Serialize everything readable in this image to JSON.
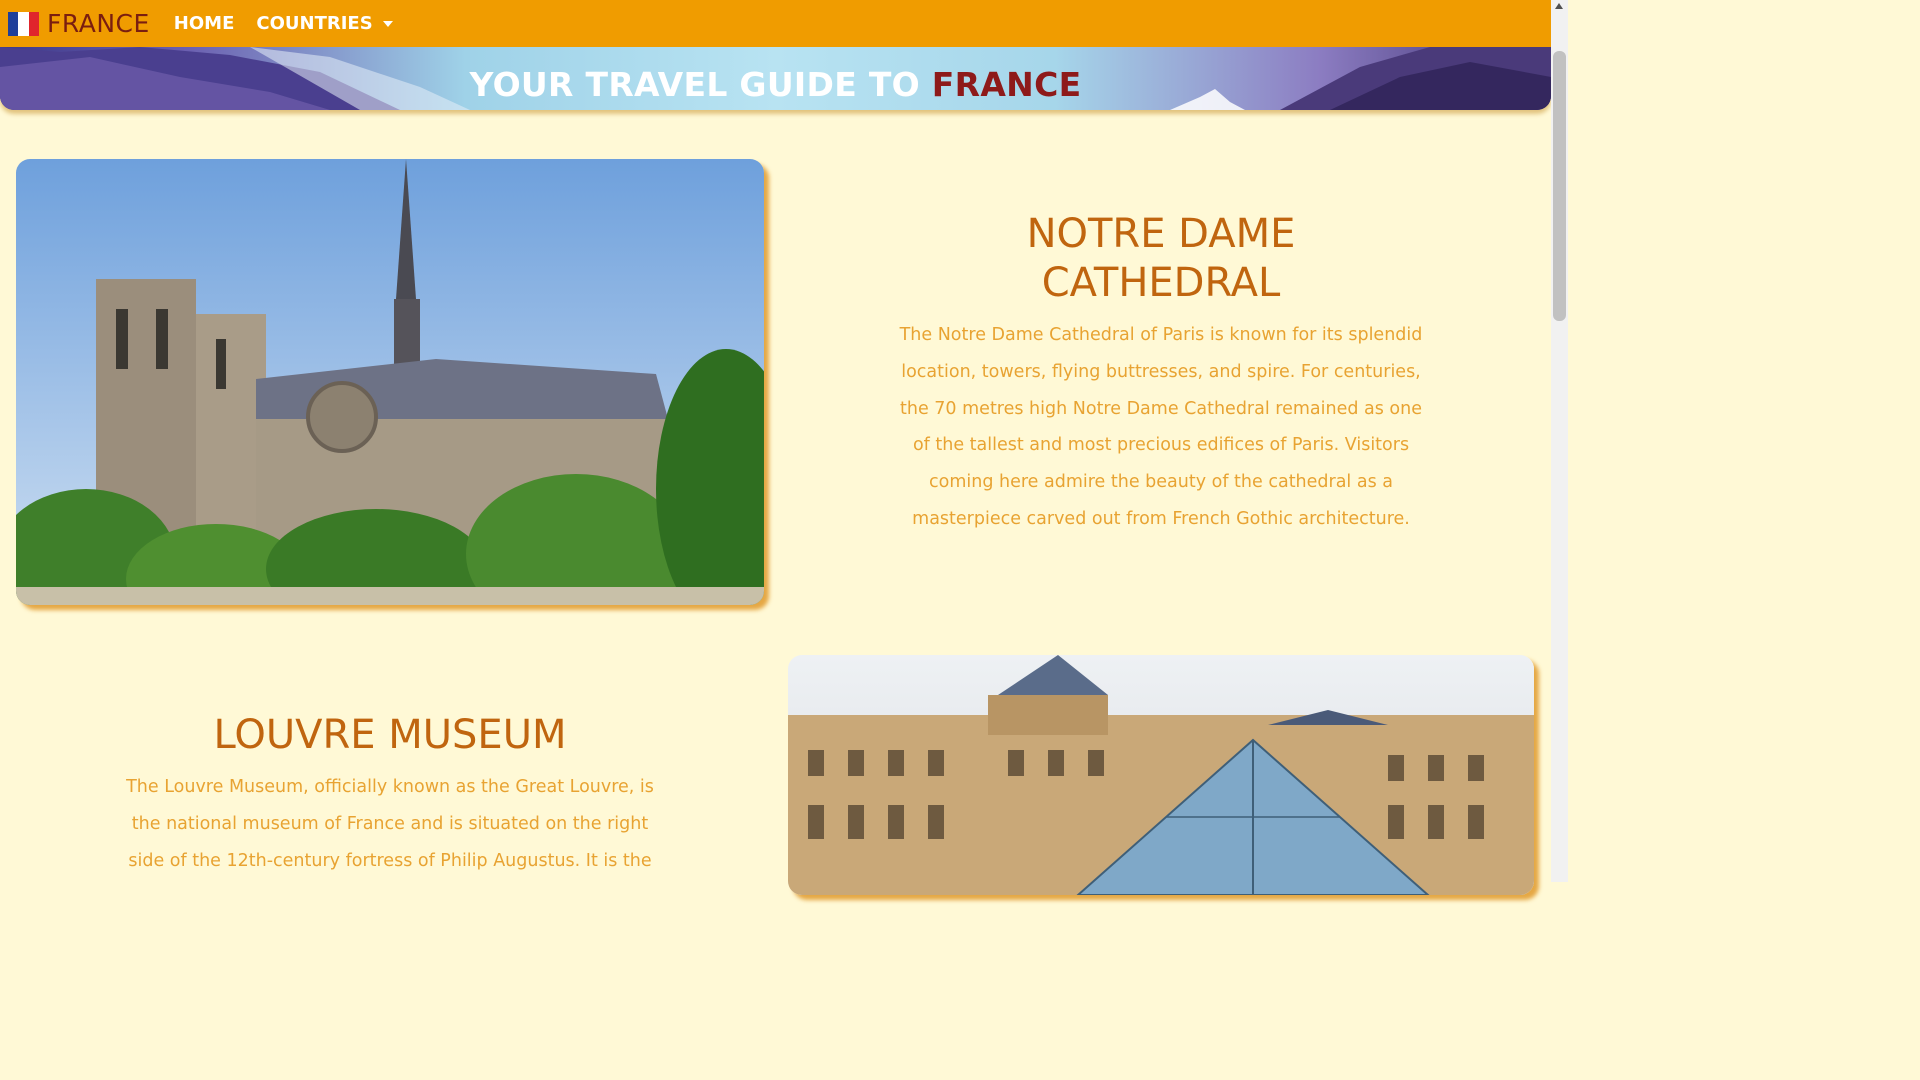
{
  "navbar": {
    "brand": "FRANCE",
    "flag_icon": "france-flag-icon",
    "flag_colors": [
      "#1f3f9a",
      "#ffffff",
      "#e0252c"
    ],
    "links": [
      {
        "label": "HOME"
      },
      {
        "label": "COUNTRIES",
        "icon": "caret-down-icon"
      }
    ],
    "background": "#f09c00"
  },
  "hero": {
    "title_prefix": "YOUR TRAVEL GUIDE TO",
    "title_accent": "FRANCE"
  },
  "sections": [
    {
      "title_line1": "NOTRE DAME",
      "title_line2": "CATHEDRAL",
      "paragraph_lines": [
        "The Notre Dame Cathedral of Paris is known for its splendid",
        "location, towers, flying buttresses, and spire. For centuries,",
        "the 70 metres high Notre Dame Cathedral remained as one",
        "of the tallest and most precious edifices of Paris. Visitors",
        "coming here admire the beauty of the cathedral as a",
        "masterpiece carved out from French Gothic architecture."
      ]
    },
    {
      "title_line1": "LOUVRE MUSEUM",
      "paragraph_lines": [
        "The Louvre Museum, officially known as the Great Louvre, is",
        "the national museum of France and is situated on the right",
        "side of the 12th-century fortress of Philip Augustus. It is the"
      ]
    }
  ],
  "colors": {
    "page_background": "#fff9d6",
    "heading": "#c0650f",
    "body_text": "#e8a332",
    "brand_text": "#7a1e10",
    "accent_red": "#8e1a1a"
  }
}
